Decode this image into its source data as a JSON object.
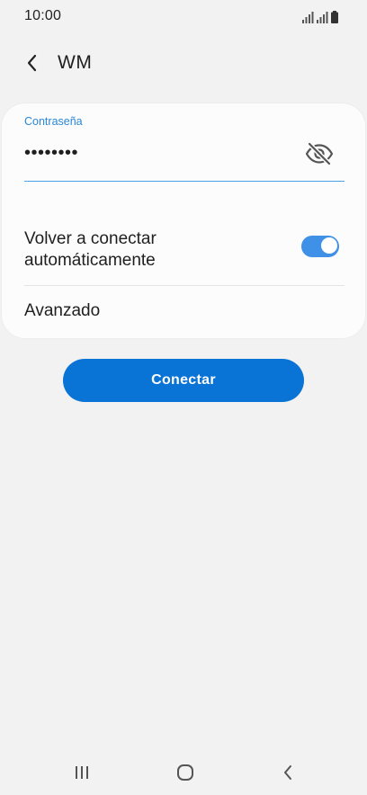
{
  "status_bar": {
    "time": "10:00",
    "icons": [
      "signal-icon",
      "signal-icon",
      "battery-icon"
    ]
  },
  "header": {
    "title": "WM",
    "back_icon": "chevron-left-icon"
  },
  "password": {
    "label": "Contraseña",
    "masked_value": "••••••••",
    "visibility_icon": "eye-off-icon"
  },
  "settings": {
    "auto_reconnect": {
      "label": "Volver a conectar automáticamente",
      "enabled": true
    },
    "advanced": {
      "label": "Avanzado"
    }
  },
  "connect_button": {
    "label": "Conectar"
  },
  "nav": {
    "recents_icon": "recents-icon",
    "home_icon": "home-icon",
    "back_icon": "back-icon"
  },
  "colors": {
    "accent": "#0a73d6",
    "toggle_on": "#3e91e6",
    "label_blue": "#2a87d6",
    "background": "#f2f2f2",
    "card": "#fcfcfc"
  }
}
